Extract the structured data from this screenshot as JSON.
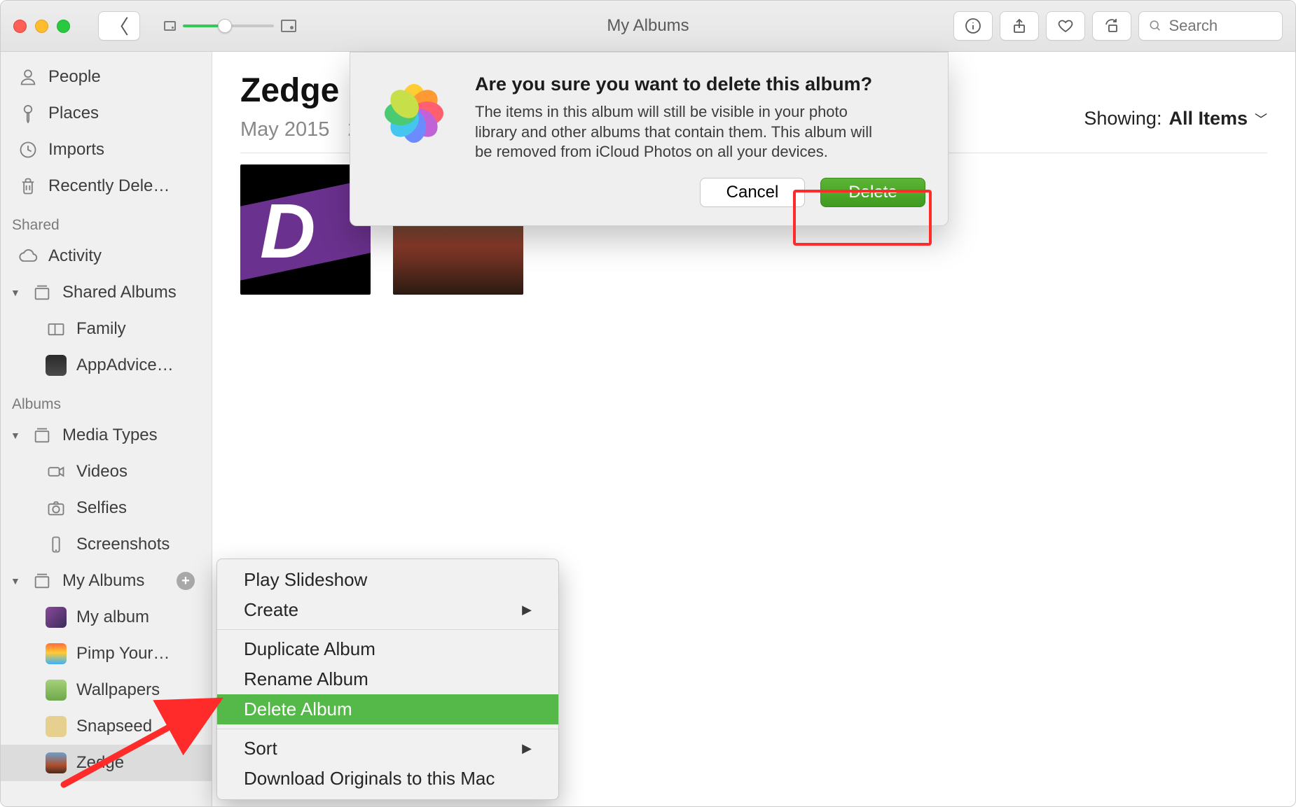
{
  "titlebar": {
    "window_title": "My Albums",
    "search_placeholder": "Search"
  },
  "sidebar": {
    "top_items": [
      {
        "icon": "person",
        "label": "People"
      },
      {
        "icon": "pin",
        "label": "Places"
      },
      {
        "icon": "clock",
        "label": "Imports"
      },
      {
        "icon": "trash",
        "label": "Recently Dele…"
      }
    ],
    "shared_header": "Shared",
    "activity_label": "Activity",
    "shared_albums_label": "Shared Albums",
    "shared_children": [
      {
        "label": "Family"
      },
      {
        "label": "AppAdvice…"
      }
    ],
    "albums_header": "Albums",
    "media_types_label": "Media Types",
    "media_children": [
      {
        "label": "Videos"
      },
      {
        "label": "Selfies"
      },
      {
        "label": "Screenshots"
      }
    ],
    "my_albums_label": "My Albums",
    "my_albums_children": [
      {
        "label": "My album"
      },
      {
        "label": "Pimp Your…"
      },
      {
        "label": "Wallpapers"
      },
      {
        "label": "Snapseed"
      },
      {
        "label": "Zedge"
      }
    ]
  },
  "content": {
    "album_title": "Zedge",
    "album_date": "May 2015",
    "album_count": "2",
    "showing_label": "Showing:",
    "showing_value": "All Items"
  },
  "context_menu": {
    "items": [
      "Play Slideshow",
      "Create",
      "Duplicate Album",
      "Rename Album",
      "Delete Album",
      "Sort",
      "Download Originals to this Mac"
    ]
  },
  "dialog": {
    "title": "Are you sure you want to delete this album?",
    "body": "The items in this album will still be visible in your photo library and other albums that contain them. This album will be removed from iCloud Photos on all your devices.",
    "cancel": "Cancel",
    "delete": "Delete"
  }
}
